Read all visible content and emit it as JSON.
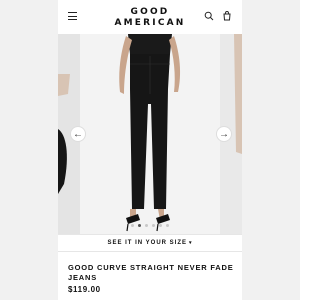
{
  "header": {
    "logo_line1": "GOOD",
    "logo_line2": "AMERICAN",
    "menu_icon": "hamburger-icon",
    "search_icon": "search-icon",
    "bag_icon": "shopping-bag-icon"
  },
  "carousel": {
    "prev_icon": "arrow-left-icon",
    "next_icon": "arrow-right-icon",
    "prev_glyph": "←",
    "next_glyph": "→",
    "dot_count": 6,
    "active_dot": 1
  },
  "size_guide": {
    "label": "SEE IT IN YOUR SIZE",
    "caret": "▾"
  },
  "product": {
    "title": "GOOD CURVE STRAIGHT NEVER FADE JEANS",
    "price": "$119.00"
  },
  "colors": {
    "text": "#111111",
    "gutter": "#f1f1f1",
    "garment": "#161616"
  }
}
